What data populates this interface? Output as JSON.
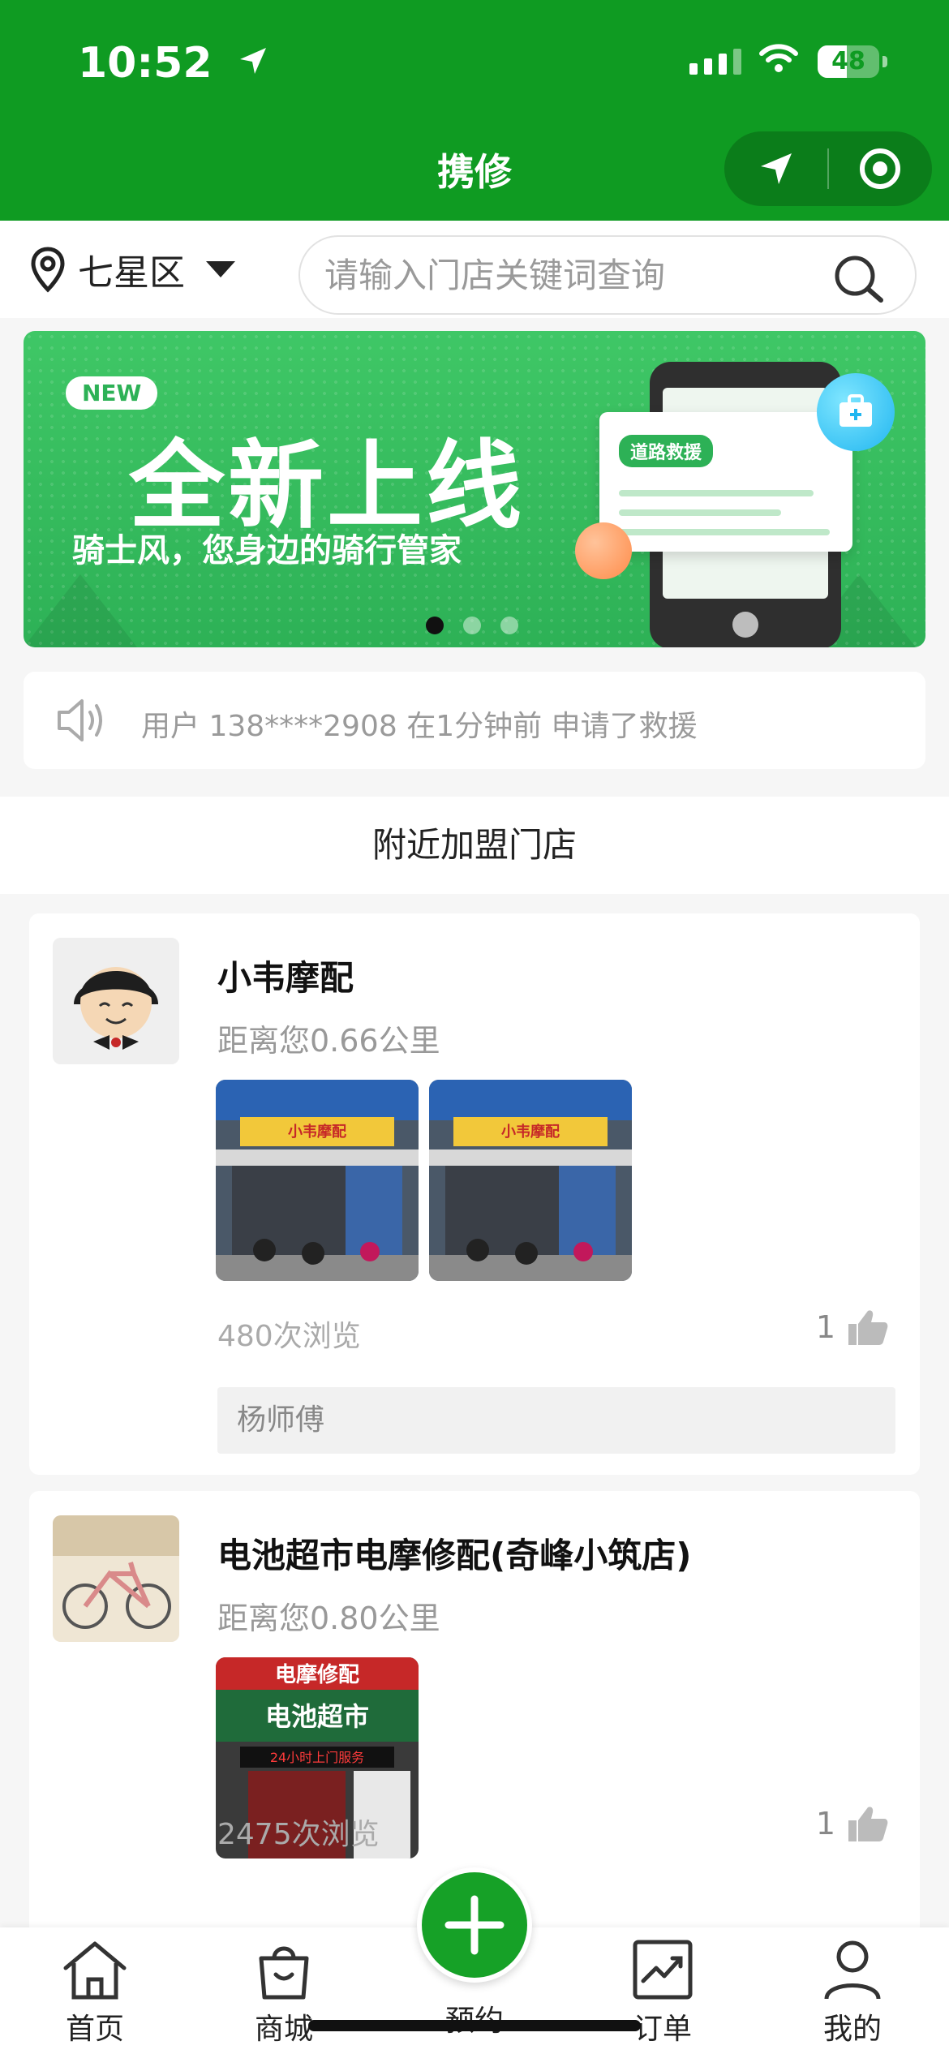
{
  "status_bar": {
    "time": "10:52",
    "battery": "48"
  },
  "nav": {
    "title": "携修"
  },
  "location": {
    "district": "七星区"
  },
  "search": {
    "placeholder": "请输入门店关键词查询"
  },
  "banner": {
    "tag": "NEW",
    "title": "全新上线",
    "subtitle": "骑士风，您身边的骑行管家",
    "card_tag": "道路救援",
    "pages": 3,
    "active_page": 1
  },
  "notice": {
    "text": "用户 138****2908 在1分钟前 申请了救援"
  },
  "section": {
    "title": "附近加盟门店"
  },
  "stores": [
    {
      "name": "小韦摩配",
      "distance": "距离您0.66公里",
      "views": "480次浏览",
      "likes": "1",
      "master": "杨师傅"
    },
    {
      "name": "电池超市电摩修配(奇峰小筑店)",
      "distance": "距离您0.80公里",
      "views": "2475次浏览",
      "likes": "1",
      "photo_sign_top": "电摩修配",
      "photo_sign_main": "电池超市",
      "photo_sign_led": "24小时上门服务"
    }
  ],
  "store1_photo_sign": "小韦摩配",
  "tabbar": {
    "home": "首页",
    "mall": "商城",
    "book": "预约",
    "orders": "订单",
    "mine": "我的"
  },
  "colors": {
    "brand_green": "#0f9b22",
    "fab_green": "#16a127",
    "muted_text": "#999999"
  }
}
